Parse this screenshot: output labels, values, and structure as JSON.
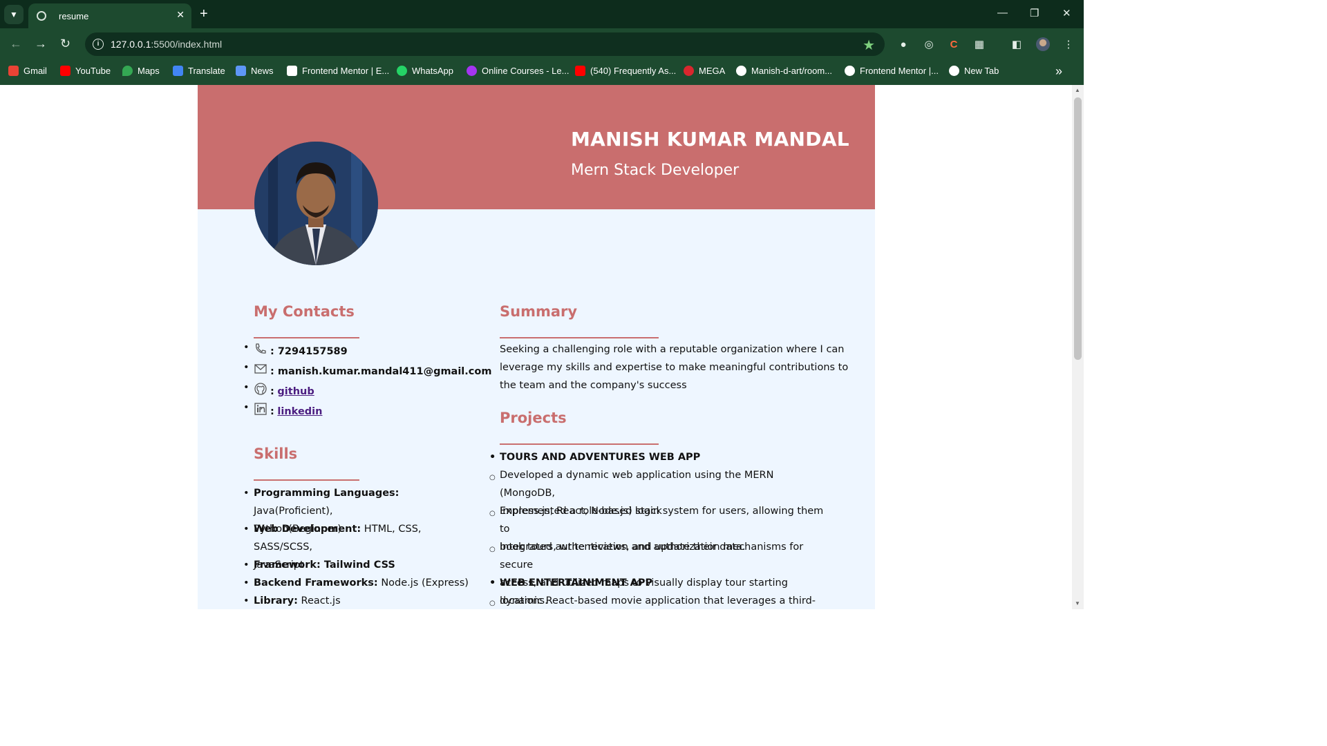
{
  "browser": {
    "tab_title": "resume",
    "url_host": "127.0.0.1",
    "url_rest": ":5500/index.html",
    "bookmarks": [
      {
        "label": "Gmail",
        "icon": "gmail-icon"
      },
      {
        "label": "YouTube",
        "icon": "youtube-icon"
      },
      {
        "label": "Maps",
        "icon": "maps-icon"
      },
      {
        "label": "Translate",
        "icon": "translate-icon"
      },
      {
        "label": "News",
        "icon": "news-icon"
      },
      {
        "label": "Frontend Mentor | E...",
        "icon": "frontend-mentor-icon"
      },
      {
        "label": "WhatsApp",
        "icon": "whatsapp-icon"
      },
      {
        "label": "Online Courses - Le...",
        "icon": "udemy-icon"
      },
      {
        "label": "(540) Frequently As...",
        "icon": "youtube-icon"
      },
      {
        "label": "MEGA",
        "icon": "mega-icon"
      },
      {
        "label": "Manish-d-art/room...",
        "icon": "github-icon"
      },
      {
        "label": "Frontend Mentor |...",
        "icon": "globe-icon"
      },
      {
        "label": "New Tab",
        "icon": "globe-icon"
      }
    ]
  },
  "resume": {
    "name": "MANISH KUMAR MANDAL",
    "role": "Mern Stack Developer",
    "contacts_heading": "My Contacts",
    "contacts": {
      "phone": ": 7294157589",
      "email": ": manish.kumar.mandal411@gmail.com",
      "github_prefix": ":",
      "github_link": "github",
      "linkedin_prefix": ":",
      "linkedin_link": "linkedin"
    },
    "skills_heading": "Skills",
    "skills": [
      {
        "label": "Programming Languages:",
        "value": " Java(Proficient),",
        "cont": "Python(Beginner)"
      },
      {
        "label": "Web Development:",
        "value": " HTML, CSS, SASS/SCSS,",
        "cont": "JavaScript"
      },
      {
        "label": "Framework: Tailwind CSS",
        "value": ""
      },
      {
        "label": "Backend Frameworks:",
        "value": " Node.js (Express)"
      },
      {
        "label": "Library:",
        "value": " React.js"
      }
    ],
    "summary_heading": "Summary",
    "summary_lines": [
      "Seeking a challenging role with a reputable organization where I can",
      "leverage my skills and expertise to make meaningful contributions to",
      "the team and the company's success"
    ],
    "projects_heading": "Projects",
    "projects": {
      "p1_title": "TOURS AND ADVENTURES WEB APP",
      "p1_d1a": "Developed a dynamic web application using the MERN (MongoDB,",
      "p1_d1b": "Express.js, React, Node.js) stack",
      "p1_d2a": "Implemented a role-based login system for users, allowing them to",
      "p1_d2b": "book tours, write reviews, and update their data.",
      "p1_d3a": "Integrated authentication and authorization mechanisms for secure",
      "p1_d3b": "access, and utilized maps to visually display tour starting locations.",
      "p2_title": "WEB ENTERTAINIMENT APP",
      "p2_d1a": "dynamic React-based movie application that leverages a third-party"
    }
  },
  "colors": {
    "accent": "#c96e6e",
    "page_bg": "#eef6ff",
    "chrome_bg": "#1d4a2f",
    "tabbar_bg": "#0d2c1c"
  }
}
